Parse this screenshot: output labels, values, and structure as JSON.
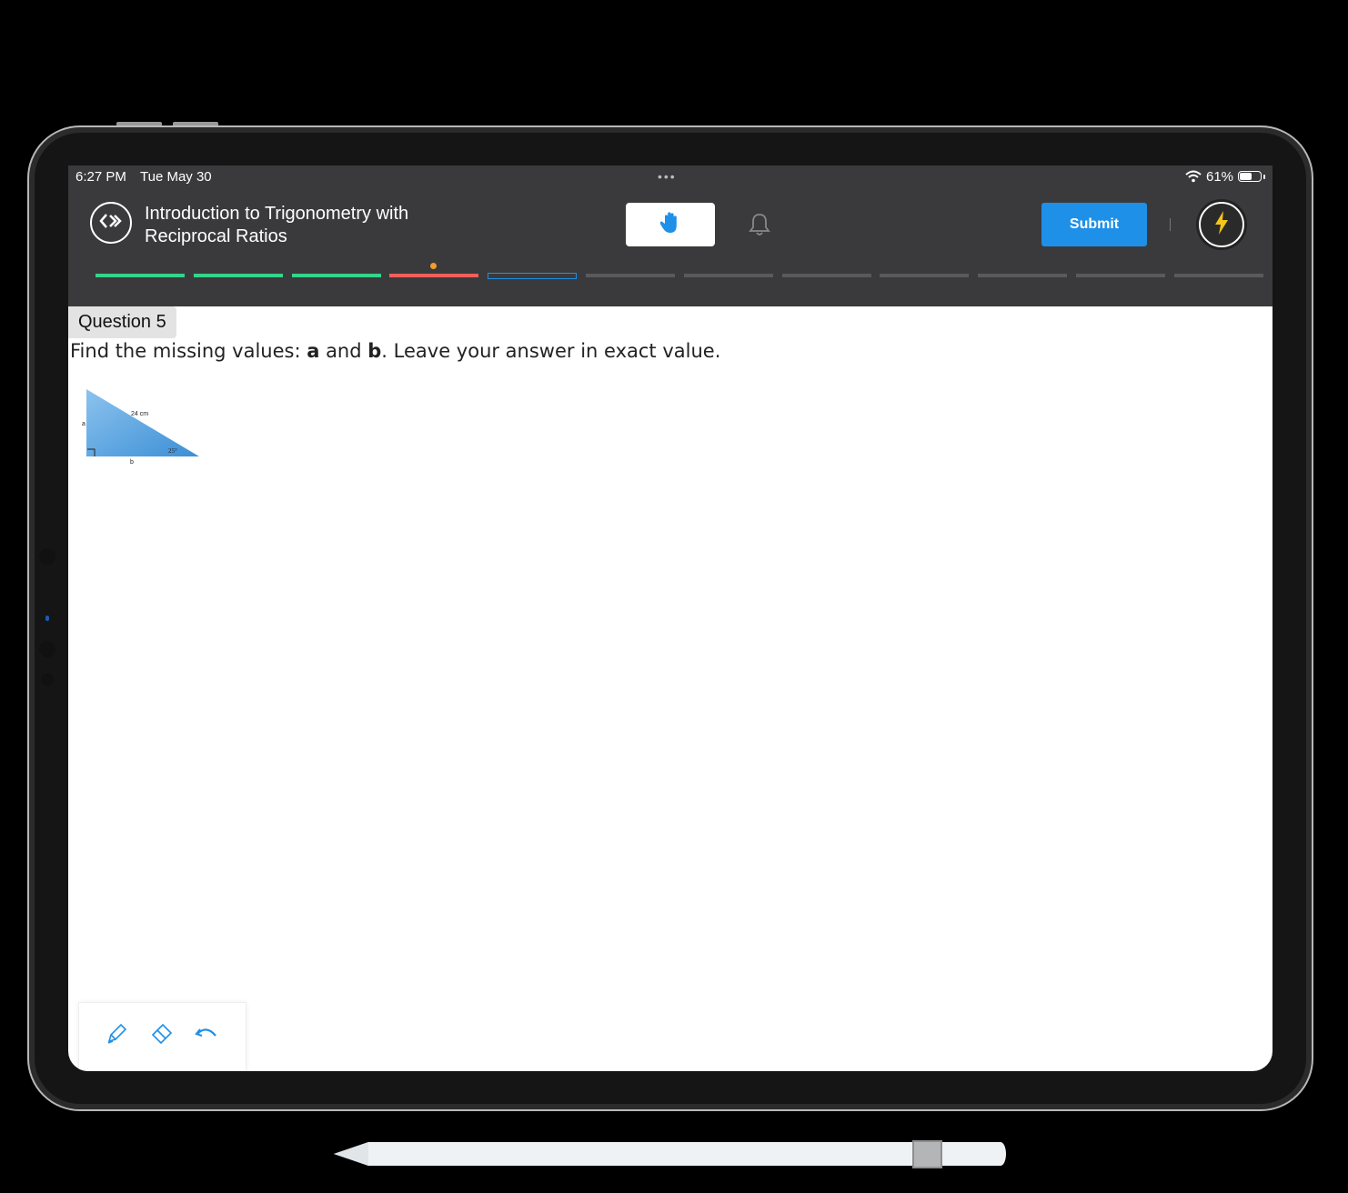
{
  "status_bar": {
    "time": "6:27 PM",
    "date": "Tue May 30",
    "battery": "61%",
    "battery_level": 0.61
  },
  "header": {
    "title_line1": "Introduction to Trigonometry with",
    "title_line2": "Reciprocal Ratios",
    "submit_label": "Submit",
    "icons": [
      "exit-icon",
      "raise-hand-icon",
      "bell-icon",
      "lightning-icon",
      "wifi-icon",
      "battery-icon"
    ]
  },
  "progress": {
    "segments": [
      "correct",
      "correct",
      "correct",
      "wrong",
      "current",
      "pending",
      "pending",
      "pending",
      "pending",
      "pending",
      "pending",
      "pending"
    ],
    "flagged_index": 3
  },
  "question": {
    "label": "Question 5",
    "text_before": "Find the missing values: ",
    "var_a": "a",
    "text_mid": " and ",
    "var_b": "b",
    "text_after": ". Leave your answer in exact value."
  },
  "figure": {
    "hypotenuse_label": "24 cm",
    "side_a_label": "a",
    "side_b_label": "b",
    "angle_label": "25°"
  },
  "toolbar": {
    "tools": [
      "pen-icon",
      "eraser-icon",
      "undo-icon"
    ]
  },
  "colors": {
    "accent": "#1e90e8",
    "correct": "#35d48a",
    "wrong": "#f0605b",
    "flag": "#f39c2a",
    "header_bg": "#3a3a3c"
  }
}
